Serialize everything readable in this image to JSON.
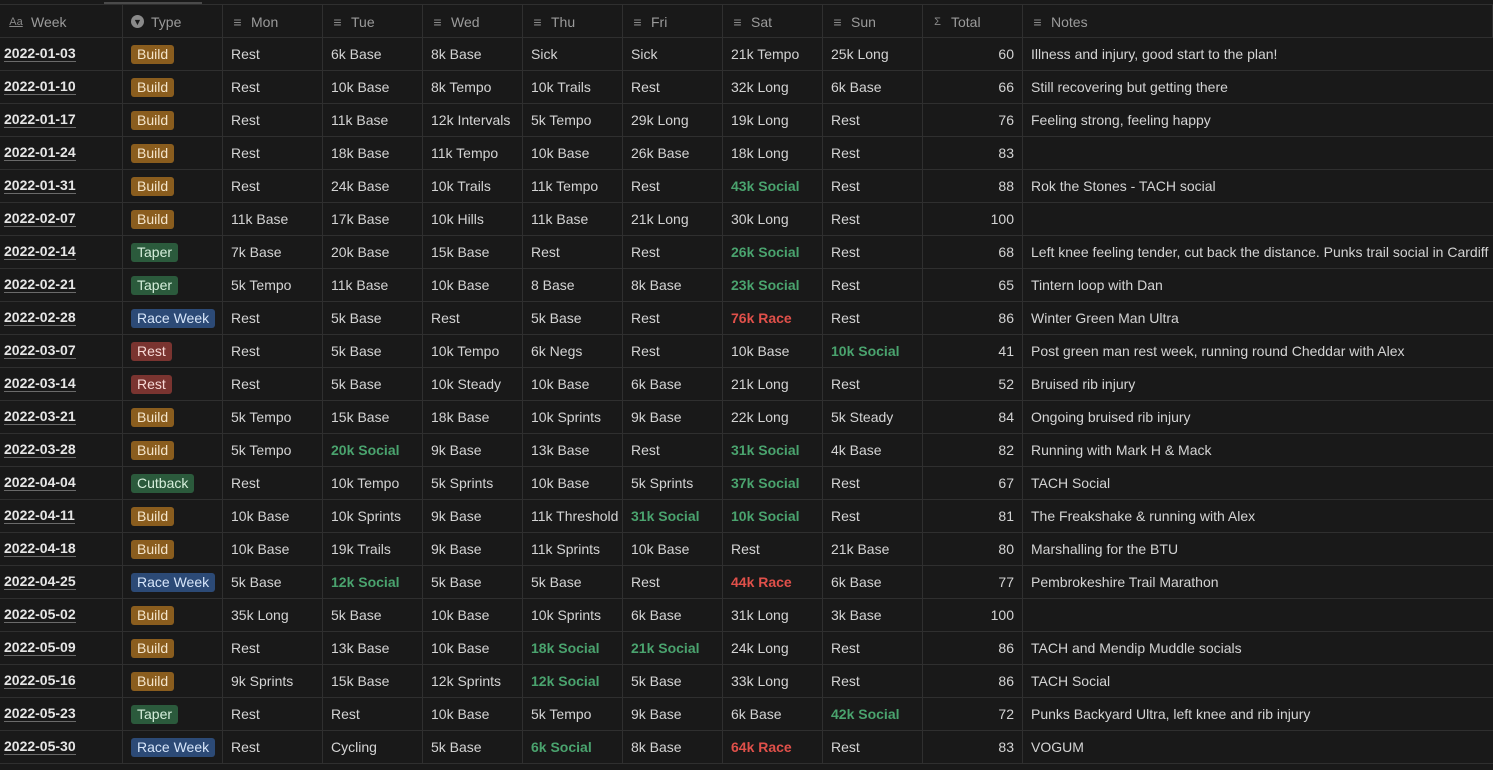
{
  "columns": [
    {
      "label": "Week",
      "icon": "Aa"
    },
    {
      "label": "Type",
      "icon": "select-icon"
    },
    {
      "label": "Mon",
      "icon": "text-icon"
    },
    {
      "label": "Tue",
      "icon": "text-icon"
    },
    {
      "label": "Wed",
      "icon": "text-icon"
    },
    {
      "label": "Thu",
      "icon": "text-icon"
    },
    {
      "label": "Fri",
      "icon": "text-icon"
    },
    {
      "label": "Sat",
      "icon": "text-icon"
    },
    {
      "label": "Sun",
      "icon": "text-icon"
    },
    {
      "label": "Total",
      "icon": "sigma-icon"
    },
    {
      "label": "Notes",
      "icon": "text-icon"
    }
  ],
  "colors": {
    "social": "#4aa36e",
    "race": "#e0504a",
    "build": "#8a5d1e",
    "taper": "#2b5a3c",
    "race_week": "#2c4a76",
    "rest": "#7a3430",
    "cutback": "#2b5a3c"
  },
  "rows": [
    {
      "week": "2022-01-03",
      "type": "Build",
      "days": [
        "Rest",
        "6k Base",
        "8k Base",
        "Sick",
        "Sick",
        "21k Tempo",
        "25k Long"
      ],
      "total": "60",
      "notes": "Illness and injury, good start to the plan!"
    },
    {
      "week": "2022-01-10",
      "type": "Build",
      "days": [
        "Rest",
        "10k Base",
        "8k Tempo",
        "10k Trails",
        "Rest",
        "32k Long",
        "6k Base"
      ],
      "total": "66",
      "notes": "Still recovering but getting there"
    },
    {
      "week": "2022-01-17",
      "type": "Build",
      "days": [
        "Rest",
        "11k Base",
        "12k Intervals",
        "5k Tempo",
        "29k Long",
        "19k Long",
        "Rest"
      ],
      "total": "76",
      "notes": "Feeling strong, feeling happy"
    },
    {
      "week": "2022-01-24",
      "type": "Build",
      "days": [
        "Rest",
        "18k Base",
        "11k Tempo",
        "10k Base",
        "26k Base",
        "18k Long",
        "Rest"
      ],
      "total": "83",
      "notes": ""
    },
    {
      "week": "2022-01-31",
      "type": "Build",
      "days": [
        "Rest",
        "24k Base",
        "10k Trails",
        "11k Tempo",
        "Rest",
        "43k Social",
        "Rest"
      ],
      "total": "88",
      "notes": "Rok the Stones - TACH social"
    },
    {
      "week": "2022-02-07",
      "type": "Build",
      "days": [
        "11k Base",
        "17k Base",
        "10k Hills",
        "11k Base",
        "21k Long",
        "30k Long",
        "Rest"
      ],
      "total": "100",
      "notes": ""
    },
    {
      "week": "2022-02-14",
      "type": "Taper",
      "days": [
        "7k Base",
        "20k Base",
        "15k Base",
        "Rest",
        "Rest",
        "26k Social",
        "Rest"
      ],
      "total": "68",
      "notes": "Left knee feeling tender, cut back the distance. Punks trail social in Cardiff"
    },
    {
      "week": "2022-02-21",
      "type": "Taper",
      "days": [
        "5k Tempo",
        "11k Base",
        "10k Base",
        "8 Base",
        "8k Base",
        "23k Social",
        "Rest"
      ],
      "total": "65",
      "notes": "Tintern loop with Dan"
    },
    {
      "week": "2022-02-28",
      "type": "Race Week",
      "days": [
        "Rest",
        "5k Base",
        "Rest",
        "5k Base",
        "Rest",
        "76k Race",
        "Rest"
      ],
      "total": "86",
      "notes": "Winter Green Man Ultra"
    },
    {
      "week": "2022-03-07",
      "type": "Rest",
      "days": [
        "Rest",
        "5k Base",
        "10k Tempo",
        "6k Negs",
        "Rest",
        "10k Base",
        "10k Social"
      ],
      "total": "41",
      "notes": "Post green man rest week, running round Cheddar with Alex"
    },
    {
      "week": "2022-03-14",
      "type": "Rest",
      "days": [
        "Rest",
        "5k Base",
        "10k Steady",
        "10k Base",
        "6k Base",
        "21k Long",
        "Rest"
      ],
      "total": "52",
      "notes": "Bruised rib injury"
    },
    {
      "week": "2022-03-21",
      "type": "Build",
      "days": [
        "5k Tempo",
        "15k Base",
        "18k Base",
        "10k Sprints",
        "9k Base",
        "22k Long",
        "5k Steady"
      ],
      "total": "84",
      "notes": "Ongoing bruised rib injury"
    },
    {
      "week": "2022-03-28",
      "type": "Build",
      "days": [
        "5k Tempo",
        "20k Social",
        "9k Base",
        "13k Base",
        "Rest",
        "31k Social",
        "4k Base"
      ],
      "total": "82",
      "notes": "Running with Mark H & Mack"
    },
    {
      "week": "2022-04-04",
      "type": "Cutback",
      "days": [
        "Rest",
        "10k Tempo",
        "5k Sprints",
        "10k Base",
        "5k Sprints",
        "37k Social",
        "Rest"
      ],
      "total": "67",
      "notes": "TACH Social"
    },
    {
      "week": "2022-04-11",
      "type": "Build",
      "days": [
        "10k Base",
        "10k Sprints",
        "9k Base",
        "11k Threshold",
        "31k Social",
        "10k Social",
        "Rest"
      ],
      "total": "81",
      "notes": "The Freakshake & running with Alex"
    },
    {
      "week": "2022-04-18",
      "type": "Build",
      "days": [
        "10k Base",
        "19k Trails",
        "9k Base",
        "11k Sprints",
        "10k Base",
        "Rest",
        "21k Base"
      ],
      "total": "80",
      "notes": "Marshalling for the BTU"
    },
    {
      "week": "2022-04-25",
      "type": "Race Week",
      "days": [
        "5k Base",
        "12k Social",
        "5k Base",
        "5k Base",
        "Rest",
        "44k Race",
        "6k Base"
      ],
      "total": "77",
      "notes": "Pembrokeshire Trail Marathon"
    },
    {
      "week": "2022-05-02",
      "type": "Build",
      "days": [
        "35k Long",
        "5k Base",
        "10k Base",
        "10k Sprints",
        "6k Base",
        "31k Long",
        "3k Base"
      ],
      "total": "100",
      "notes": ""
    },
    {
      "week": "2022-05-09",
      "type": "Build",
      "days": [
        "Rest",
        "13k Base",
        "10k Base",
        "18k Social",
        "21k Social",
        "24k Long",
        "Rest"
      ],
      "total": "86",
      "notes": "TACH and Mendip Muddle socials"
    },
    {
      "week": "2022-05-16",
      "type": "Build",
      "days": [
        "9k Sprints",
        "15k Base",
        "12k Sprints",
        "12k Social",
        "5k Base",
        "33k Long",
        "Rest"
      ],
      "total": "86",
      "notes": "TACH Social"
    },
    {
      "week": "2022-05-23",
      "type": "Taper",
      "days": [
        "Rest",
        "Rest",
        "10k Base",
        "5k Tempo",
        "9k Base",
        "6k Base",
        "42k Social"
      ],
      "total": "72",
      "notes": "Punks Backyard Ultra, left knee and rib injury"
    },
    {
      "week": "2022-05-30",
      "type": "Race Week",
      "days": [
        "Rest",
        "Cycling",
        "5k Base",
        "6k Social",
        "8k Base",
        "64k Race",
        "Rest"
      ],
      "total": "83",
      "notes": "VOGUM"
    }
  ]
}
